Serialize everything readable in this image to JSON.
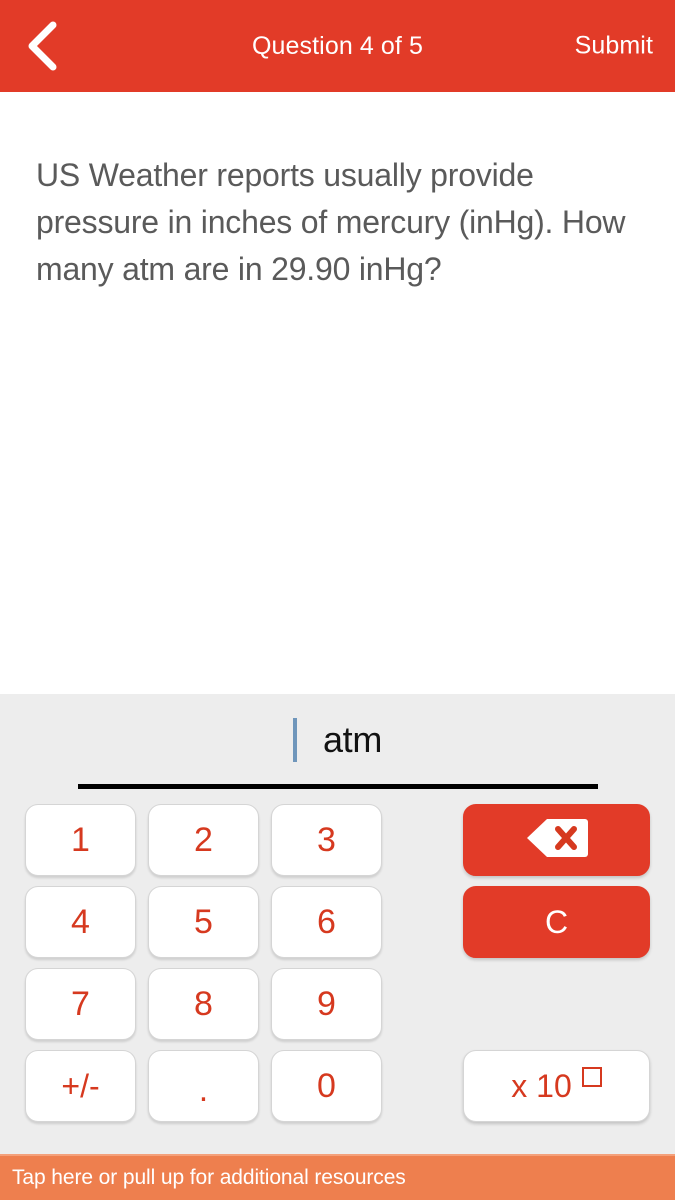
{
  "header": {
    "back_icon": "chevron-left-icon",
    "title": "Question 4 of 5",
    "submit_label": "Submit"
  },
  "question": {
    "text": "US Weather reports usually provide pressure in inches of mercury (inHg). How many atm are in 29.90 inHg?"
  },
  "answer": {
    "value": "",
    "unit": "atm",
    "caret_color": "#6f96bb"
  },
  "keypad": {
    "rows": [
      {
        "digits": [
          "1",
          "2",
          "3"
        ],
        "action": {
          "type": "backspace",
          "icon": "backspace-icon",
          "label": ""
        }
      },
      {
        "digits": [
          "4",
          "5",
          "6"
        ],
        "action": {
          "type": "clear",
          "icon": "",
          "label": "C"
        }
      },
      {
        "digits": [
          "7",
          "8",
          "9"
        ],
        "action": {
          "type": "none",
          "icon": "",
          "label": ""
        }
      },
      {
        "digits": [
          "+/-",
          ".",
          "0"
        ],
        "action": {
          "type": "scientific",
          "icon": "",
          "label": "x 10"
        }
      }
    ]
  },
  "footer": {
    "text": "Tap here or pull up for additional resources"
  },
  "colors": {
    "brand_red": "#e23b28",
    "key_red": "#d6391f",
    "footer_orange": "#ee7f4e",
    "panel_gray": "#ededed",
    "question_gray": "#5a5a5a"
  }
}
